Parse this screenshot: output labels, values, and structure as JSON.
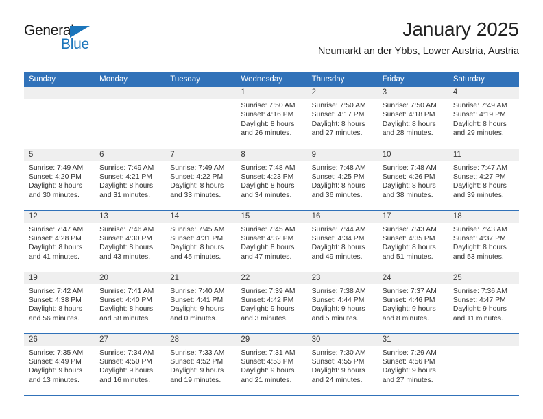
{
  "brand": {
    "line1": "General",
    "line2": "Blue",
    "triangle_color": "#1b75bb"
  },
  "header": {
    "title": "January 2025",
    "subtitle": "Neumarkt an der Ybbs, Lower Austria, Austria"
  },
  "theme": {
    "header_bg": "#3172b9",
    "daynum_bg": "#efefef",
    "row_divider": "#3172b9"
  },
  "weekday_headers": [
    "Sunday",
    "Monday",
    "Tuesday",
    "Wednesday",
    "Thursday",
    "Friday",
    "Saturday"
  ],
  "weeks": [
    [
      {
        "day": "",
        "sunrise": "",
        "sunset": "",
        "daylight_1": "",
        "daylight_2": ""
      },
      {
        "day": "",
        "sunrise": "",
        "sunset": "",
        "daylight_1": "",
        "daylight_2": ""
      },
      {
        "day": "",
        "sunrise": "",
        "sunset": "",
        "daylight_1": "",
        "daylight_2": ""
      },
      {
        "day": "1",
        "sunrise": "Sunrise: 7:50 AM",
        "sunset": "Sunset: 4:16 PM",
        "daylight_1": "Daylight: 8 hours",
        "daylight_2": "and 26 minutes."
      },
      {
        "day": "2",
        "sunrise": "Sunrise: 7:50 AM",
        "sunset": "Sunset: 4:17 PM",
        "daylight_1": "Daylight: 8 hours",
        "daylight_2": "and 27 minutes."
      },
      {
        "day": "3",
        "sunrise": "Sunrise: 7:50 AM",
        "sunset": "Sunset: 4:18 PM",
        "daylight_1": "Daylight: 8 hours",
        "daylight_2": "and 28 minutes."
      },
      {
        "day": "4",
        "sunrise": "Sunrise: 7:49 AM",
        "sunset": "Sunset: 4:19 PM",
        "daylight_1": "Daylight: 8 hours",
        "daylight_2": "and 29 minutes."
      }
    ],
    [
      {
        "day": "5",
        "sunrise": "Sunrise: 7:49 AM",
        "sunset": "Sunset: 4:20 PM",
        "daylight_1": "Daylight: 8 hours",
        "daylight_2": "and 30 minutes."
      },
      {
        "day": "6",
        "sunrise": "Sunrise: 7:49 AM",
        "sunset": "Sunset: 4:21 PM",
        "daylight_1": "Daylight: 8 hours",
        "daylight_2": "and 31 minutes."
      },
      {
        "day": "7",
        "sunrise": "Sunrise: 7:49 AM",
        "sunset": "Sunset: 4:22 PM",
        "daylight_1": "Daylight: 8 hours",
        "daylight_2": "and 33 minutes."
      },
      {
        "day": "8",
        "sunrise": "Sunrise: 7:48 AM",
        "sunset": "Sunset: 4:23 PM",
        "daylight_1": "Daylight: 8 hours",
        "daylight_2": "and 34 minutes."
      },
      {
        "day": "9",
        "sunrise": "Sunrise: 7:48 AM",
        "sunset": "Sunset: 4:25 PM",
        "daylight_1": "Daylight: 8 hours",
        "daylight_2": "and 36 minutes."
      },
      {
        "day": "10",
        "sunrise": "Sunrise: 7:48 AM",
        "sunset": "Sunset: 4:26 PM",
        "daylight_1": "Daylight: 8 hours",
        "daylight_2": "and 38 minutes."
      },
      {
        "day": "11",
        "sunrise": "Sunrise: 7:47 AM",
        "sunset": "Sunset: 4:27 PM",
        "daylight_1": "Daylight: 8 hours",
        "daylight_2": "and 39 minutes."
      }
    ],
    [
      {
        "day": "12",
        "sunrise": "Sunrise: 7:47 AM",
        "sunset": "Sunset: 4:28 PM",
        "daylight_1": "Daylight: 8 hours",
        "daylight_2": "and 41 minutes."
      },
      {
        "day": "13",
        "sunrise": "Sunrise: 7:46 AM",
        "sunset": "Sunset: 4:30 PM",
        "daylight_1": "Daylight: 8 hours",
        "daylight_2": "and 43 minutes."
      },
      {
        "day": "14",
        "sunrise": "Sunrise: 7:45 AM",
        "sunset": "Sunset: 4:31 PM",
        "daylight_1": "Daylight: 8 hours",
        "daylight_2": "and 45 minutes."
      },
      {
        "day": "15",
        "sunrise": "Sunrise: 7:45 AM",
        "sunset": "Sunset: 4:32 PM",
        "daylight_1": "Daylight: 8 hours",
        "daylight_2": "and 47 minutes."
      },
      {
        "day": "16",
        "sunrise": "Sunrise: 7:44 AM",
        "sunset": "Sunset: 4:34 PM",
        "daylight_1": "Daylight: 8 hours",
        "daylight_2": "and 49 minutes."
      },
      {
        "day": "17",
        "sunrise": "Sunrise: 7:43 AM",
        "sunset": "Sunset: 4:35 PM",
        "daylight_1": "Daylight: 8 hours",
        "daylight_2": "and 51 minutes."
      },
      {
        "day": "18",
        "sunrise": "Sunrise: 7:43 AM",
        "sunset": "Sunset: 4:37 PM",
        "daylight_1": "Daylight: 8 hours",
        "daylight_2": "and 53 minutes."
      }
    ],
    [
      {
        "day": "19",
        "sunrise": "Sunrise: 7:42 AM",
        "sunset": "Sunset: 4:38 PM",
        "daylight_1": "Daylight: 8 hours",
        "daylight_2": "and 56 minutes."
      },
      {
        "day": "20",
        "sunrise": "Sunrise: 7:41 AM",
        "sunset": "Sunset: 4:40 PM",
        "daylight_1": "Daylight: 8 hours",
        "daylight_2": "and 58 minutes."
      },
      {
        "day": "21",
        "sunrise": "Sunrise: 7:40 AM",
        "sunset": "Sunset: 4:41 PM",
        "daylight_1": "Daylight: 9 hours",
        "daylight_2": "and 0 minutes."
      },
      {
        "day": "22",
        "sunrise": "Sunrise: 7:39 AM",
        "sunset": "Sunset: 4:42 PM",
        "daylight_1": "Daylight: 9 hours",
        "daylight_2": "and 3 minutes."
      },
      {
        "day": "23",
        "sunrise": "Sunrise: 7:38 AM",
        "sunset": "Sunset: 4:44 PM",
        "daylight_1": "Daylight: 9 hours",
        "daylight_2": "and 5 minutes."
      },
      {
        "day": "24",
        "sunrise": "Sunrise: 7:37 AM",
        "sunset": "Sunset: 4:46 PM",
        "daylight_1": "Daylight: 9 hours",
        "daylight_2": "and 8 minutes."
      },
      {
        "day": "25",
        "sunrise": "Sunrise: 7:36 AM",
        "sunset": "Sunset: 4:47 PM",
        "daylight_1": "Daylight: 9 hours",
        "daylight_2": "and 11 minutes."
      }
    ],
    [
      {
        "day": "26",
        "sunrise": "Sunrise: 7:35 AM",
        "sunset": "Sunset: 4:49 PM",
        "daylight_1": "Daylight: 9 hours",
        "daylight_2": "and 13 minutes."
      },
      {
        "day": "27",
        "sunrise": "Sunrise: 7:34 AM",
        "sunset": "Sunset: 4:50 PM",
        "daylight_1": "Daylight: 9 hours",
        "daylight_2": "and 16 minutes."
      },
      {
        "day": "28",
        "sunrise": "Sunrise: 7:33 AM",
        "sunset": "Sunset: 4:52 PM",
        "daylight_1": "Daylight: 9 hours",
        "daylight_2": "and 19 minutes."
      },
      {
        "day": "29",
        "sunrise": "Sunrise: 7:31 AM",
        "sunset": "Sunset: 4:53 PM",
        "daylight_1": "Daylight: 9 hours",
        "daylight_2": "and 21 minutes."
      },
      {
        "day": "30",
        "sunrise": "Sunrise: 7:30 AM",
        "sunset": "Sunset: 4:55 PM",
        "daylight_1": "Daylight: 9 hours",
        "daylight_2": "and 24 minutes."
      },
      {
        "day": "31",
        "sunrise": "Sunrise: 7:29 AM",
        "sunset": "Sunset: 4:56 PM",
        "daylight_1": "Daylight: 9 hours",
        "daylight_2": "and 27 minutes."
      },
      {
        "day": "",
        "sunrise": "",
        "sunset": "",
        "daylight_1": "",
        "daylight_2": ""
      }
    ]
  ]
}
